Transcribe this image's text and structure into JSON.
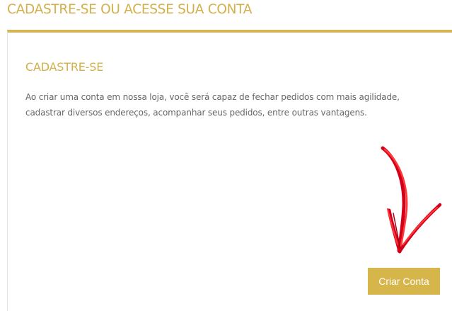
{
  "header": {
    "title": "CADASTRE-SE OU ACESSE SUA CONTA"
  },
  "register": {
    "title": "CADASTRE-SE",
    "description": "Ao criar uma conta em nossa loja, você será capaz de fechar pedidos com mais agilidade, cadastrar diversos endereços, acompanhar seus pedidos, entre outras vantagens.",
    "button_label": "Criar Conta"
  },
  "colors": {
    "accent": "#d5b453",
    "text": "#666666",
    "arrow": "#e0001a"
  },
  "icons": {
    "annotation": "red-arrow-icon"
  }
}
